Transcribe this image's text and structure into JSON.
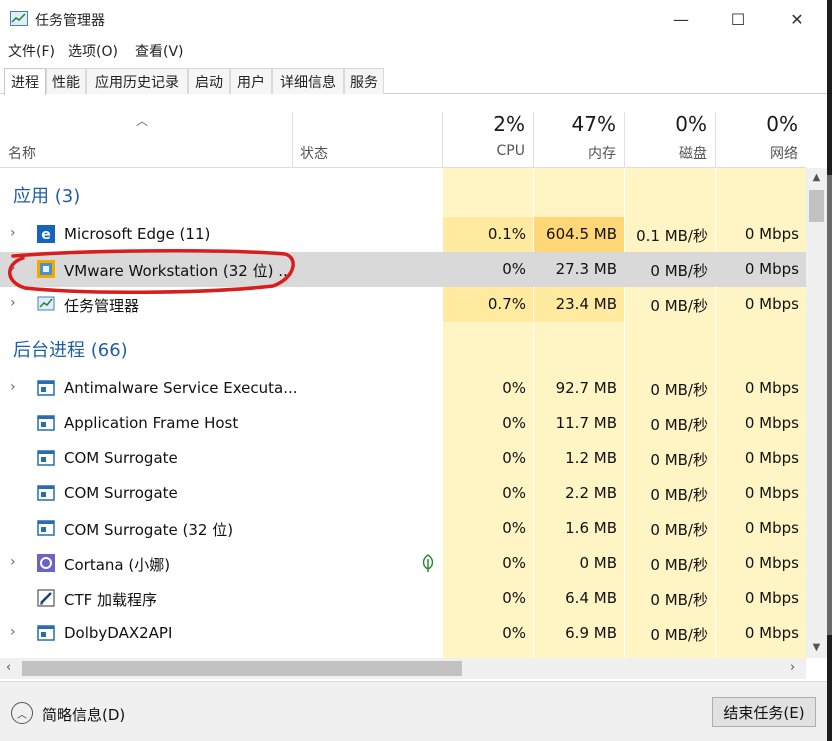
{
  "window": {
    "title": "任务管理器"
  },
  "menu": [
    "文件(F)",
    "选项(O)",
    "查看(V)"
  ],
  "tabs": [
    "进程",
    "性能",
    "应用历史记录",
    "启动",
    "用户",
    "详细信息",
    "服务"
  ],
  "active_tab": "进程",
  "columns": {
    "name": "名称",
    "status": "状态",
    "cpu": {
      "pct": "2%",
      "label": "CPU"
    },
    "memory": {
      "pct": "47%",
      "label": "内存"
    },
    "disk": {
      "pct": "0%",
      "label": "磁盘"
    },
    "network": {
      "pct": "0%",
      "label": "网络"
    }
  },
  "groups": {
    "apps": "应用 (3)",
    "background": "后台进程 (66)"
  },
  "apps": [
    {
      "name": "Microsoft Edge (11)",
      "icon": "edge-icon",
      "cpu": "0.1%",
      "mem": "604.5 MB",
      "disk": "0.1 MB/秒",
      "net": "0 Mbps"
    },
    {
      "name": "VMware Workstation (32 位) ...",
      "icon": "vmware-icon",
      "cpu": "0%",
      "mem": "27.3 MB",
      "disk": "0 MB/秒",
      "net": "0 Mbps"
    },
    {
      "name": "任务管理器",
      "icon": "task-manager-icon",
      "cpu": "0.7%",
      "mem": "23.4 MB",
      "disk": "0 MB/秒",
      "net": "0 Mbps"
    }
  ],
  "background": [
    {
      "name": "Antimalware Service Executa...",
      "icon": "process-icon",
      "cpu": "0%",
      "mem": "92.7 MB",
      "disk": "0 MB/秒",
      "net": "0 Mbps"
    },
    {
      "name": "Application Frame Host",
      "icon": "process-icon",
      "cpu": "0%",
      "mem": "11.7 MB",
      "disk": "0 MB/秒",
      "net": "0 Mbps"
    },
    {
      "name": "COM Surrogate",
      "icon": "process-icon",
      "cpu": "0%",
      "mem": "1.2 MB",
      "disk": "0 MB/秒",
      "net": "0 Mbps"
    },
    {
      "name": "COM Surrogate",
      "icon": "process-icon",
      "cpu": "0%",
      "mem": "2.2 MB",
      "disk": "0 MB/秒",
      "net": "0 Mbps"
    },
    {
      "name": "COM Surrogate (32 位)",
      "icon": "process-icon",
      "cpu": "0%",
      "mem": "1.6 MB",
      "disk": "0 MB/秒",
      "net": "0 Mbps"
    },
    {
      "name": "Cortana (小娜)",
      "icon": "cortana-icon",
      "cpu": "0%",
      "mem": "0 MB",
      "disk": "0 MB/秒",
      "net": "0 Mbps"
    },
    {
      "name": "CTF 加载程序",
      "icon": "ctf-icon",
      "cpu": "0%",
      "mem": "6.4 MB",
      "disk": "0 MB/秒",
      "net": "0 Mbps"
    },
    {
      "name": "DolbyDAX2API",
      "icon": "process-icon",
      "cpu": "0%",
      "mem": "6.9 MB",
      "disk": "0 MB/秒",
      "net": "0 Mbps"
    }
  ],
  "footer": {
    "fewer_details": "简略信息(D)",
    "end_task": "结束任务(E)"
  },
  "colors": {
    "accent_blue": "#1f5fa8",
    "heat_light": "#fff4c4",
    "heat_high": "#ffd777",
    "annotation_red": "#d91c1c",
    "selection": "#d9d9d9"
  }
}
